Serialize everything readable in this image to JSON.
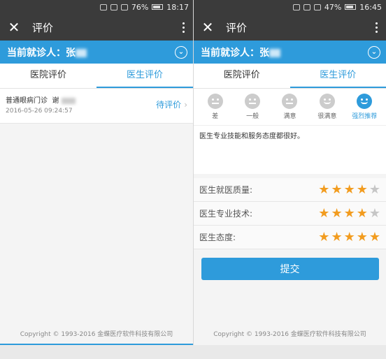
{
  "left": {
    "status": {
      "battery": "76%",
      "time": "18:17"
    },
    "title": "评价",
    "patient": "当前就诊人：张",
    "tabs": [
      "医院评价",
      "医生评价"
    ],
    "item": {
      "dept": "普通眼病门诊",
      "doctor": "谢",
      "date": "2016-05-26 09:24:57",
      "action": "待评价"
    },
    "footer": "Copyright © 1993-2016 金蝶医疗软件科技有限公司"
  },
  "right": {
    "status": {
      "battery": "47%",
      "time": "16:45"
    },
    "title": "评价",
    "patient": "当前就诊人：张",
    "tabs": [
      "医院评价",
      "医生评价"
    ],
    "faces": [
      "差",
      "一般",
      "满意",
      "很满意",
      "强烈推荐"
    ],
    "selected_face": 4,
    "comment": "医生专业技能和服务态度都很好。",
    "ratings": [
      {
        "label": "医生就医质量:",
        "stars": 4
      },
      {
        "label": "医生专业技术:",
        "stars": 4
      },
      {
        "label": "医生态度:",
        "stars": 5
      }
    ],
    "submit": "提交",
    "footer": "Copyright © 1993-2016 金蝶医疗软件科技有限公司"
  },
  "colors": {
    "accent": "#2e9bdb",
    "star": "#f29c1f",
    "topbar": "#3b3b3b"
  }
}
